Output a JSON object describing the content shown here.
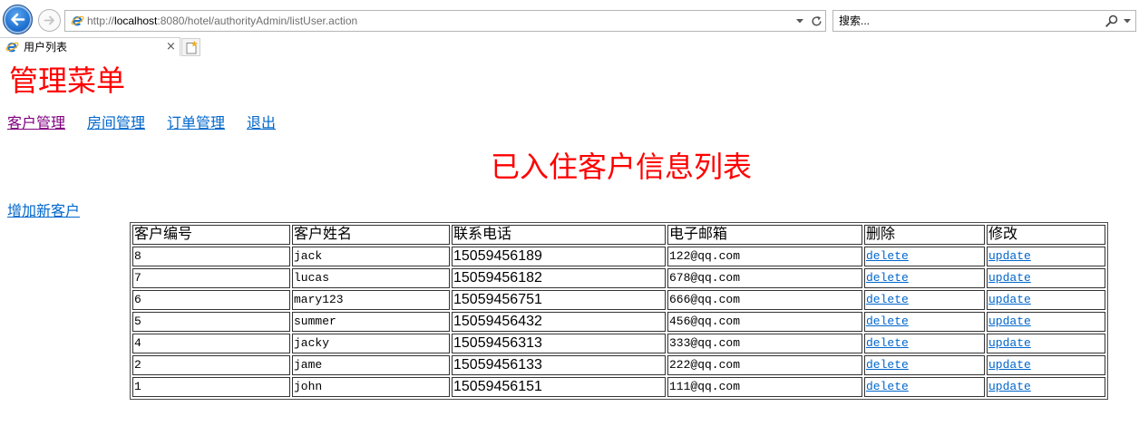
{
  "browser": {
    "address": {
      "scheme": "http://",
      "host": "localhost",
      "path": ":8080/hotel/authorityAdmin/listUser.action"
    },
    "search": {
      "placeholder": "搜索..."
    },
    "tab": {
      "title": "用户列表",
      "close_label": "×"
    }
  },
  "icons": {
    "back": "back-arrow-icon",
    "forward": "forward-arrow-icon",
    "page": "internet-explorer-icon",
    "address_dropdown": "chevron-down-icon",
    "refresh": "refresh-icon",
    "search": "search-icon",
    "search_dropdown": "chevron-down-icon",
    "new_tab": "new-tab-icon"
  },
  "colors": {
    "heading": "#ff0000",
    "link": "#0066cc",
    "visited_link": "#800080",
    "back_button": "#1e6fcf"
  },
  "page": {
    "menu_title": "管理菜单",
    "nav": [
      {
        "label": "客户管理",
        "visited": true
      },
      {
        "label": "房间管理",
        "visited": false
      },
      {
        "label": "订单管理",
        "visited": false
      },
      {
        "label": "退出",
        "visited": false
      }
    ],
    "list_title": "已入住客户信息列表",
    "add_link": "增加新客户",
    "table": {
      "headers": [
        "客户编号",
        "客户姓名",
        "联系电话",
        "电子邮箱",
        "删除",
        "修改"
      ],
      "rows": [
        {
          "id": "8",
          "name": "jack",
          "phone": "15059456189",
          "email": "122@qq.com",
          "delete": "delete",
          "update": "update"
        },
        {
          "id": "7",
          "name": "lucas",
          "phone": "15059456182",
          "email": "678@qq.com",
          "delete": "delete",
          "update": "update"
        },
        {
          "id": "6",
          "name": "mary123",
          "phone": "15059456751",
          "email": "666@qq.com",
          "delete": "delete",
          "update": "update"
        },
        {
          "id": "5",
          "name": "summer",
          "phone": "15059456432",
          "email": "456@qq.com",
          "delete": "delete",
          "update": "update"
        },
        {
          "id": "4",
          "name": "jacky",
          "phone": "15059456313",
          "email": "333@qq.com",
          "delete": "delete",
          "update": "update"
        },
        {
          "id": "2",
          "name": "jame",
          "phone": "15059456133",
          "email": "222@qq.com",
          "delete": "delete",
          "update": "update"
        },
        {
          "id": "1",
          "name": "john",
          "phone": "15059456151",
          "email": "111@qq.com",
          "delete": "delete",
          "update": "update"
        }
      ]
    }
  }
}
